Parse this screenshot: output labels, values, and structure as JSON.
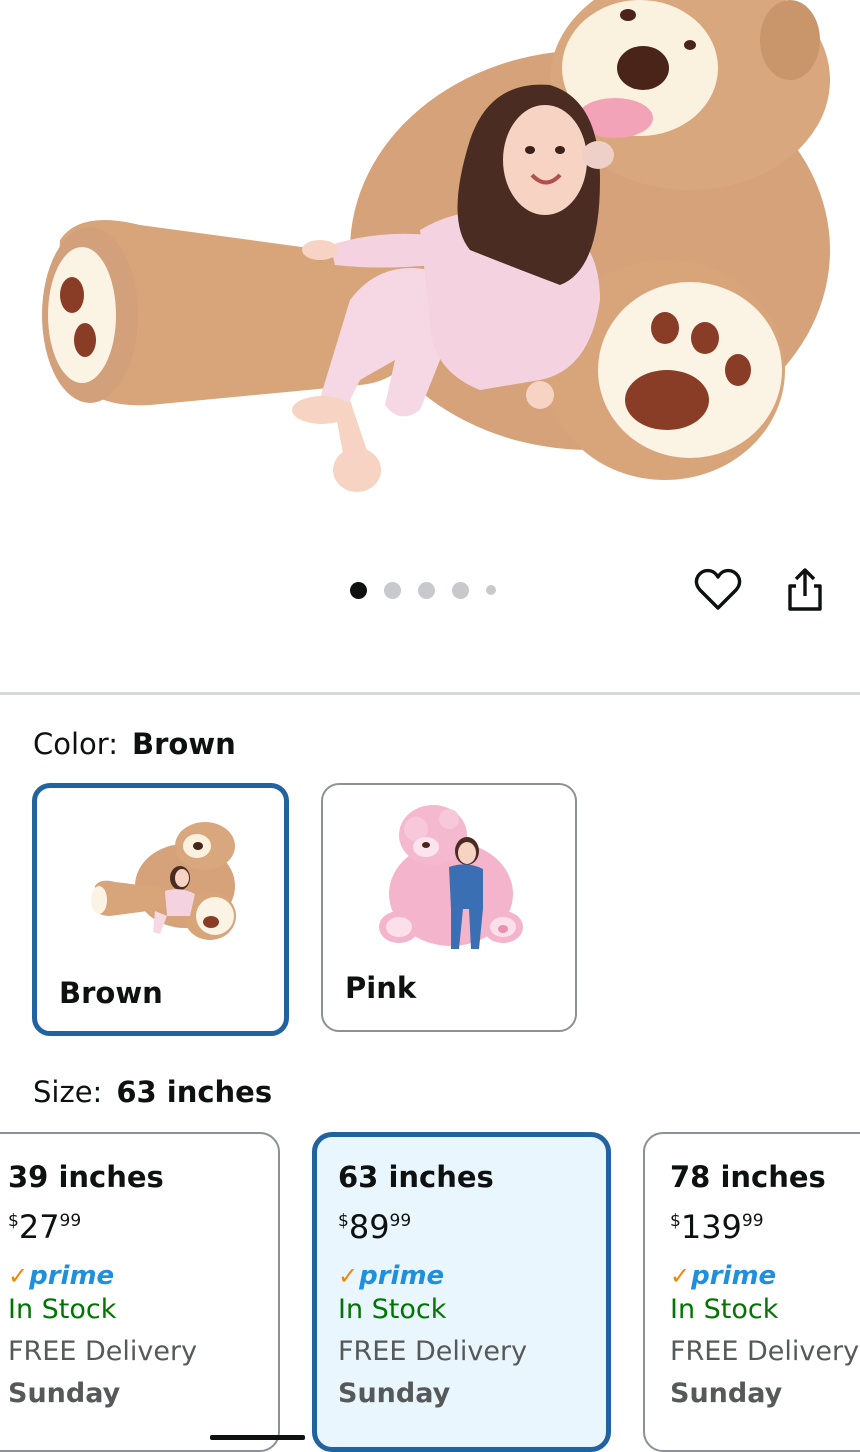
{
  "product": {
    "image_alt": "Giant brown teddy bear with girl",
    "carousel": {
      "count": 5,
      "active_index": 0
    }
  },
  "actions": {
    "wishlist_icon": "heart-icon",
    "share_icon": "share-icon"
  },
  "color": {
    "label": "Color:",
    "selected": "Brown",
    "options": [
      {
        "name": "Brown",
        "selected": true
      },
      {
        "name": "Pink",
        "selected": false
      }
    ]
  },
  "size": {
    "label": "Size:",
    "selected": "63 inches",
    "options": [
      {
        "name": "39 inches",
        "price_currency": "$",
        "price_whole": "27",
        "price_fraction": "99",
        "prime": "prime",
        "stock": "In Stock",
        "delivery": "FREE Delivery",
        "day": "Sunday",
        "selected": false
      },
      {
        "name": "63 inches",
        "price_currency": "$",
        "price_whole": "89",
        "price_fraction": "99",
        "prime": "prime",
        "stock": "In Stock",
        "delivery": "FREE Delivery",
        "day": "Sunday",
        "selected": true
      },
      {
        "name": "78 inches",
        "price_currency": "$",
        "price_whole": "139",
        "price_fraction": "99",
        "prime": "prime",
        "stock": "In Stock",
        "delivery": "FREE Delivery",
        "day": "Sunday",
        "selected": false
      }
    ]
  },
  "colors": {
    "selected_border": "#2162a1",
    "selected_bg": "#e9f6fd",
    "stock_green": "#007600",
    "prime_blue": "#1e90dd",
    "prime_check": "#f08804",
    "bear_brown": "#d9a77d",
    "bear_pink": "#f4b4cc"
  }
}
